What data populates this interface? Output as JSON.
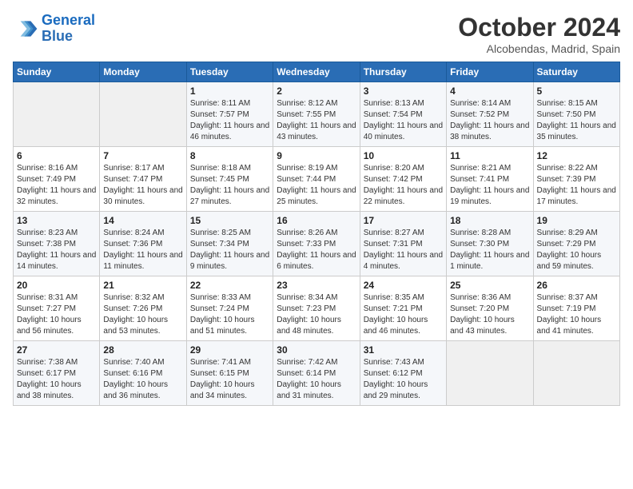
{
  "header": {
    "logo_line1": "General",
    "logo_line2": "Blue",
    "month": "October 2024",
    "location": "Alcobendas, Madrid, Spain"
  },
  "weekdays": [
    "Sunday",
    "Monday",
    "Tuesday",
    "Wednesday",
    "Thursday",
    "Friday",
    "Saturday"
  ],
  "weeks": [
    [
      {
        "day": "",
        "detail": ""
      },
      {
        "day": "",
        "detail": ""
      },
      {
        "day": "1",
        "detail": "Sunrise: 8:11 AM\nSunset: 7:57 PM\nDaylight: 11 hours and 46 minutes."
      },
      {
        "day": "2",
        "detail": "Sunrise: 8:12 AM\nSunset: 7:55 PM\nDaylight: 11 hours and 43 minutes."
      },
      {
        "day": "3",
        "detail": "Sunrise: 8:13 AM\nSunset: 7:54 PM\nDaylight: 11 hours and 40 minutes."
      },
      {
        "day": "4",
        "detail": "Sunrise: 8:14 AM\nSunset: 7:52 PM\nDaylight: 11 hours and 38 minutes."
      },
      {
        "day": "5",
        "detail": "Sunrise: 8:15 AM\nSunset: 7:50 PM\nDaylight: 11 hours and 35 minutes."
      }
    ],
    [
      {
        "day": "6",
        "detail": "Sunrise: 8:16 AM\nSunset: 7:49 PM\nDaylight: 11 hours and 32 minutes."
      },
      {
        "day": "7",
        "detail": "Sunrise: 8:17 AM\nSunset: 7:47 PM\nDaylight: 11 hours and 30 minutes."
      },
      {
        "day": "8",
        "detail": "Sunrise: 8:18 AM\nSunset: 7:45 PM\nDaylight: 11 hours and 27 minutes."
      },
      {
        "day": "9",
        "detail": "Sunrise: 8:19 AM\nSunset: 7:44 PM\nDaylight: 11 hours and 25 minutes."
      },
      {
        "day": "10",
        "detail": "Sunrise: 8:20 AM\nSunset: 7:42 PM\nDaylight: 11 hours and 22 minutes."
      },
      {
        "day": "11",
        "detail": "Sunrise: 8:21 AM\nSunset: 7:41 PM\nDaylight: 11 hours and 19 minutes."
      },
      {
        "day": "12",
        "detail": "Sunrise: 8:22 AM\nSunset: 7:39 PM\nDaylight: 11 hours and 17 minutes."
      }
    ],
    [
      {
        "day": "13",
        "detail": "Sunrise: 8:23 AM\nSunset: 7:38 PM\nDaylight: 11 hours and 14 minutes."
      },
      {
        "day": "14",
        "detail": "Sunrise: 8:24 AM\nSunset: 7:36 PM\nDaylight: 11 hours and 11 minutes."
      },
      {
        "day": "15",
        "detail": "Sunrise: 8:25 AM\nSunset: 7:34 PM\nDaylight: 11 hours and 9 minutes."
      },
      {
        "day": "16",
        "detail": "Sunrise: 8:26 AM\nSunset: 7:33 PM\nDaylight: 11 hours and 6 minutes."
      },
      {
        "day": "17",
        "detail": "Sunrise: 8:27 AM\nSunset: 7:31 PM\nDaylight: 11 hours and 4 minutes."
      },
      {
        "day": "18",
        "detail": "Sunrise: 8:28 AM\nSunset: 7:30 PM\nDaylight: 11 hours and 1 minute."
      },
      {
        "day": "19",
        "detail": "Sunrise: 8:29 AM\nSunset: 7:29 PM\nDaylight: 10 hours and 59 minutes."
      }
    ],
    [
      {
        "day": "20",
        "detail": "Sunrise: 8:31 AM\nSunset: 7:27 PM\nDaylight: 10 hours and 56 minutes."
      },
      {
        "day": "21",
        "detail": "Sunrise: 8:32 AM\nSunset: 7:26 PM\nDaylight: 10 hours and 53 minutes."
      },
      {
        "day": "22",
        "detail": "Sunrise: 8:33 AM\nSunset: 7:24 PM\nDaylight: 10 hours and 51 minutes."
      },
      {
        "day": "23",
        "detail": "Sunrise: 8:34 AM\nSunset: 7:23 PM\nDaylight: 10 hours and 48 minutes."
      },
      {
        "day": "24",
        "detail": "Sunrise: 8:35 AM\nSunset: 7:21 PM\nDaylight: 10 hours and 46 minutes."
      },
      {
        "day": "25",
        "detail": "Sunrise: 8:36 AM\nSunset: 7:20 PM\nDaylight: 10 hours and 43 minutes."
      },
      {
        "day": "26",
        "detail": "Sunrise: 8:37 AM\nSunset: 7:19 PM\nDaylight: 10 hours and 41 minutes."
      }
    ],
    [
      {
        "day": "27",
        "detail": "Sunrise: 7:38 AM\nSunset: 6:17 PM\nDaylight: 10 hours and 38 minutes."
      },
      {
        "day": "28",
        "detail": "Sunrise: 7:40 AM\nSunset: 6:16 PM\nDaylight: 10 hours and 36 minutes."
      },
      {
        "day": "29",
        "detail": "Sunrise: 7:41 AM\nSunset: 6:15 PM\nDaylight: 10 hours and 34 minutes."
      },
      {
        "day": "30",
        "detail": "Sunrise: 7:42 AM\nSunset: 6:14 PM\nDaylight: 10 hours and 31 minutes."
      },
      {
        "day": "31",
        "detail": "Sunrise: 7:43 AM\nSunset: 6:12 PM\nDaylight: 10 hours and 29 minutes."
      },
      {
        "day": "",
        "detail": ""
      },
      {
        "day": "",
        "detail": ""
      }
    ]
  ]
}
